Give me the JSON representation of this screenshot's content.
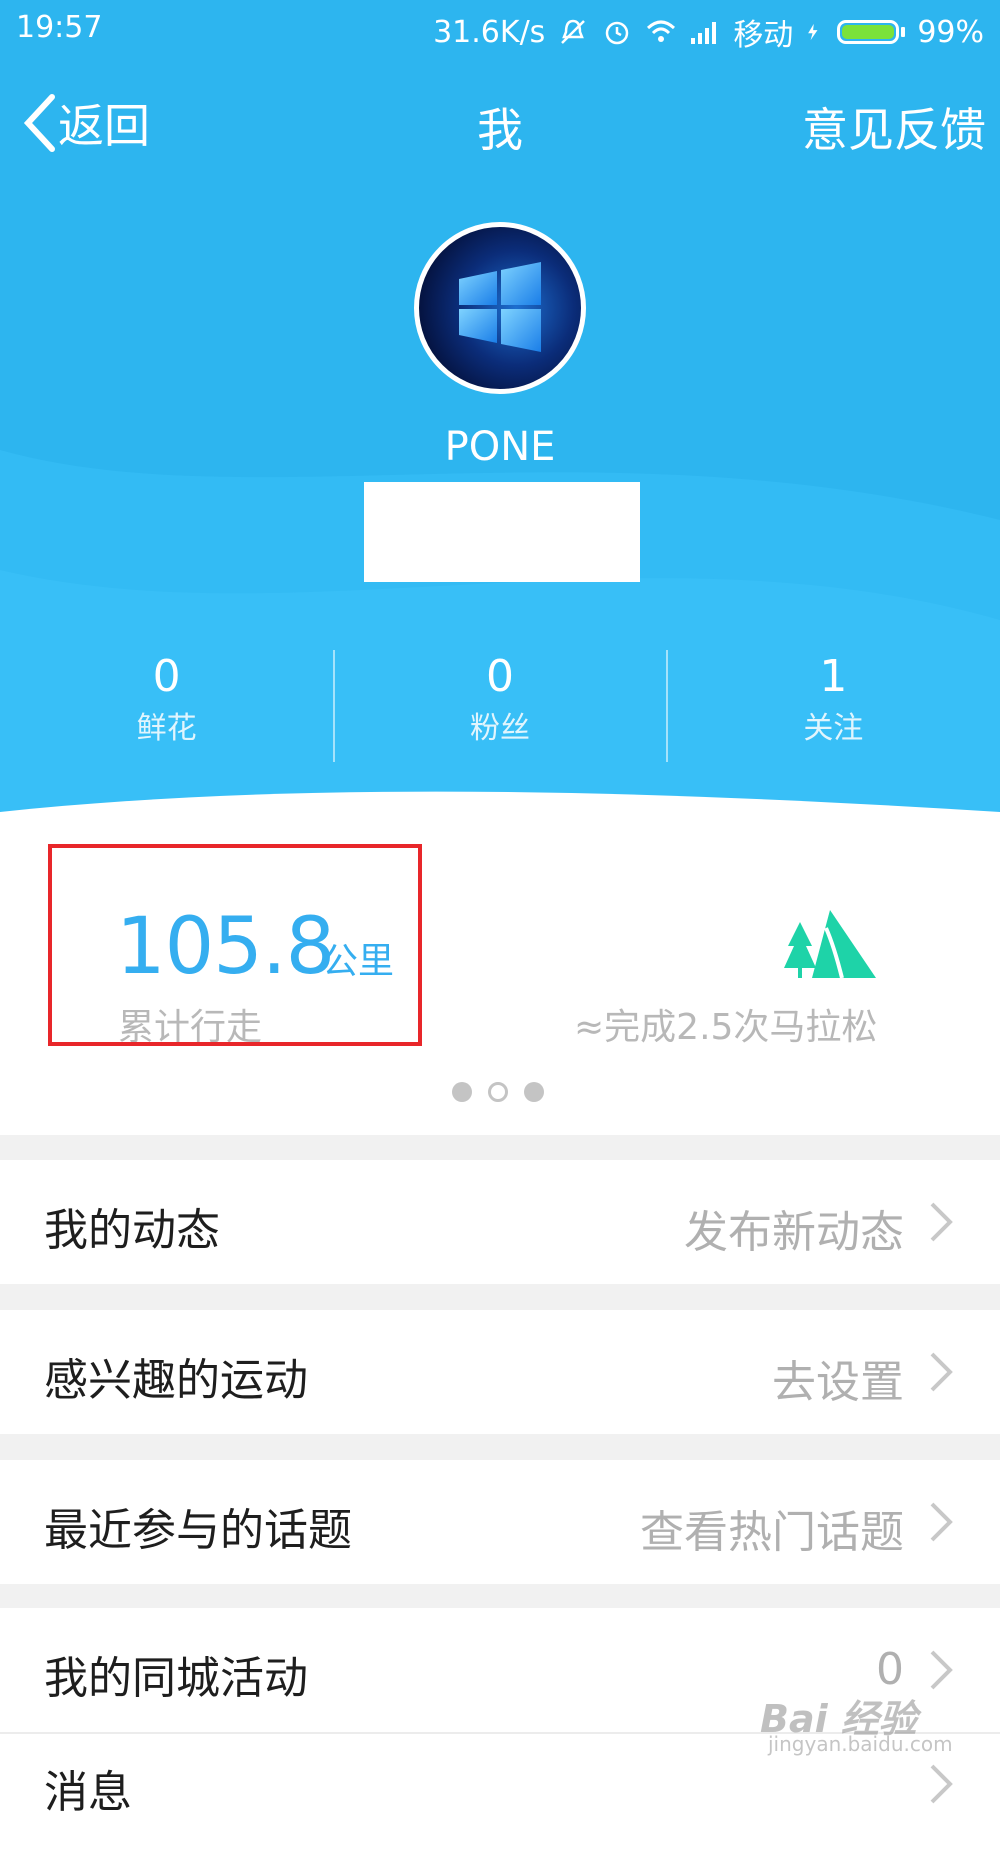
{
  "status_bar": {
    "time": "19:57",
    "speed": "31.6K/s",
    "carrier": "移动",
    "battery": "99%"
  },
  "nav": {
    "back_label": "返回",
    "title": "我",
    "feedback_label": "意见反馈"
  },
  "profile": {
    "username": "PONE"
  },
  "stats": [
    {
      "value": "0",
      "label": "鲜花"
    },
    {
      "value": "0",
      "label": "粉丝"
    },
    {
      "value": "1",
      "label": "关注"
    }
  ],
  "distance": {
    "value": "105.8",
    "unit": "公里",
    "label": "累计行走",
    "marathon": "≈完成2.5次马拉松"
  },
  "pager": {
    "count": 3,
    "active_index": 1
  },
  "menu": [
    {
      "title": "我的动态",
      "action": "发布新动态"
    },
    {
      "title": "感兴趣的运动",
      "action": "去设置"
    },
    {
      "title": "最近参与的话题",
      "action": "查看热门话题"
    },
    {
      "title": "我的同城活动",
      "action": "0"
    },
    {
      "title": "消息",
      "action": ""
    }
  ],
  "watermark": {
    "brand": "Bai 经验",
    "url": "jingyan.baidu.com"
  },
  "colors": {
    "header": "#2db5ef",
    "accent": "#35aef0",
    "mountain": "#1ed3a8",
    "highlight": "#e8262a"
  }
}
